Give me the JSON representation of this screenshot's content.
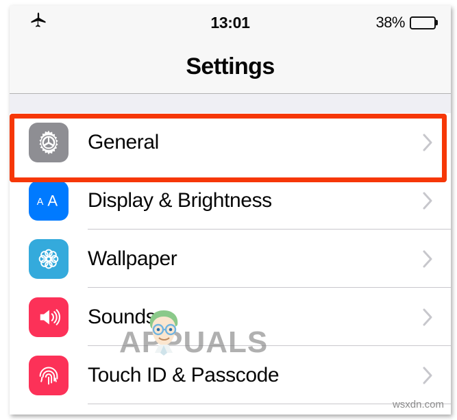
{
  "statusbar": {
    "airplane_icon": "airplane-icon",
    "time": "13:01",
    "battery_percent": "38%",
    "battery_level": 38
  },
  "navbar": {
    "title": "Settings"
  },
  "settings_list": [
    {
      "label": "General",
      "icon": "gear-icon",
      "icon_color": "#8e8e93",
      "chevron": "chevron-right-icon",
      "highlighted": true
    },
    {
      "label": "Display & Brightness",
      "icon": "text-size-aa-icon",
      "icon_color": "#007aff",
      "chevron": "chevron-right-icon",
      "highlighted": false
    },
    {
      "label": "Wallpaper",
      "icon": "flower-mandala-icon",
      "icon_color": "#34aadc",
      "chevron": "chevron-right-icon",
      "highlighted": false
    },
    {
      "label": "Sounds",
      "icon": "speaker-volume-icon",
      "icon_color": "#fc3158",
      "chevron": "chevron-right-icon",
      "highlighted": false
    },
    {
      "label": "Touch ID & Passcode",
      "icon": "fingerprint-icon",
      "icon_color": "#fc3158",
      "chevron": "chevron-right-icon",
      "highlighted": false
    }
  ],
  "annotation": {
    "target": "General",
    "color": "#f63707"
  },
  "watermarks": {
    "brand": "APPUALS",
    "site": "wsxdn.com"
  }
}
